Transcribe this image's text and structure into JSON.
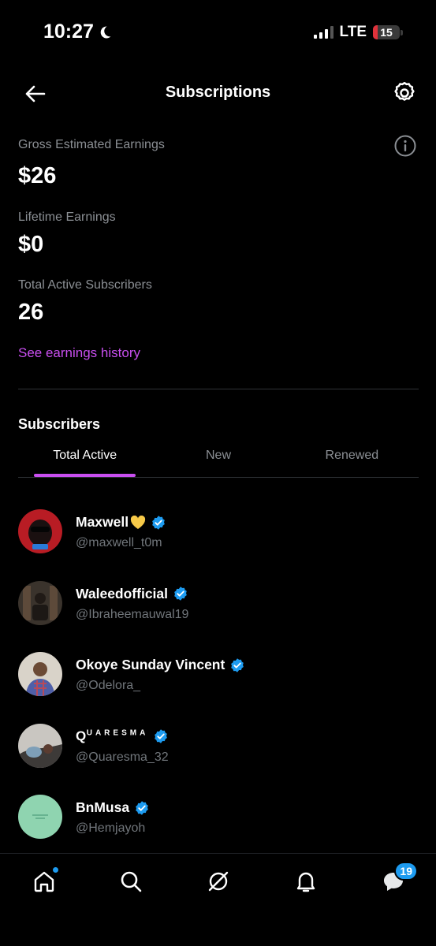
{
  "status_bar": {
    "time": "10:27",
    "network": "LTE",
    "battery": "15"
  },
  "header": {
    "title": "Subscriptions"
  },
  "stats": {
    "gross_label": "Gross Estimated Earnings",
    "gross_value": "$26",
    "lifetime_label": "Lifetime Earnings",
    "lifetime_value": "$0",
    "subscribers_label": "Total Active Subscribers",
    "subscribers_value": "26",
    "history_link": "See earnings history"
  },
  "subscribers": {
    "section_title": "Subscribers",
    "tabs": [
      {
        "label": "Total Active",
        "active": true
      },
      {
        "label": "New",
        "active": false
      },
      {
        "label": "Renewed",
        "active": false
      }
    ],
    "list": [
      {
        "name": "Maxwell",
        "handle": "@maxwell_t0m",
        "verified": true
      },
      {
        "name": "Waleedofficial",
        "handle": "@Ibraheemauwal19",
        "verified": true
      },
      {
        "name": "Okoye Sunday Vincent",
        "handle": "@Odelora_",
        "verified": true
      },
      {
        "name_first": "Q",
        "name_rest": "UARESMA",
        "handle": "@Quaresma_32",
        "verified": true
      },
      {
        "name": "BnMusa",
        "handle": "@Hemjayoh",
        "verified": true
      }
    ]
  },
  "bottom_nav": {
    "items": [
      "home-icon",
      "search-icon",
      "grok-icon",
      "notifications-icon",
      "messages-icon"
    ],
    "messages_badge": "19"
  },
  "colors": {
    "accent": "#c94ff0",
    "verified": "#1d9bf0",
    "background": "#000000"
  }
}
